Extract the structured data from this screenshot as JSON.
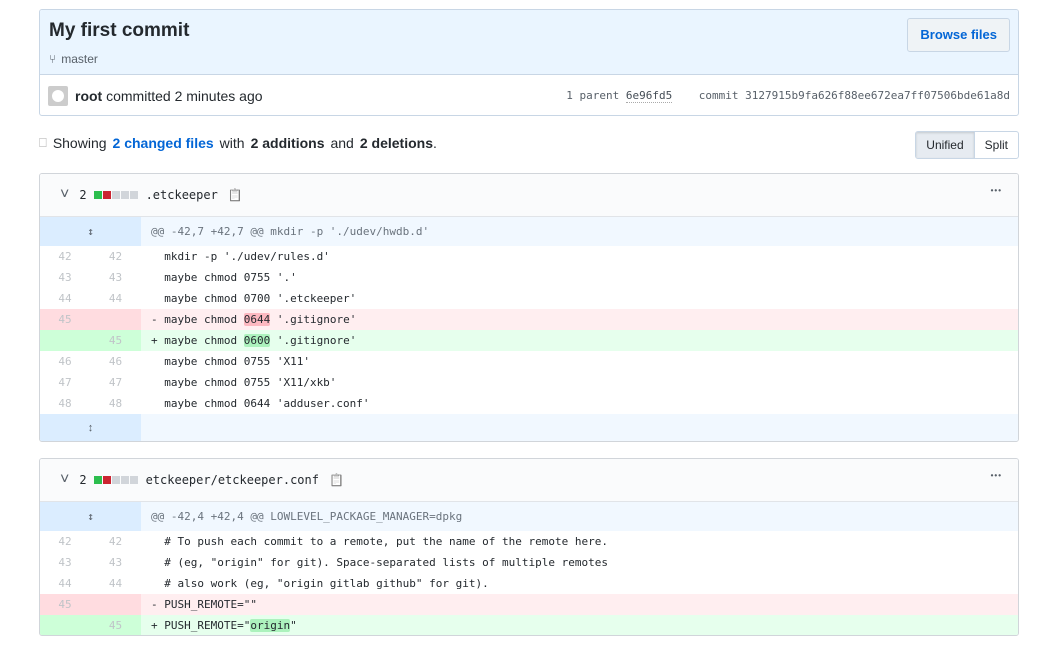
{
  "commit": {
    "title": "My first commit",
    "branch": "master",
    "browse_label": "Browse files",
    "author": "root",
    "action": "committed 2 minutes ago",
    "parent_label": "1 parent",
    "parent_sha": "6e96fd5",
    "commit_label": "commit",
    "commit_sha": "3127915b9fa626f88ee672ea7ff07506bde61a8d"
  },
  "summary": {
    "showing": "Showing",
    "files": "2 changed files",
    "with": "with",
    "additions": "2 additions",
    "and": "and",
    "deletions": "2 deletions",
    "period": "."
  },
  "view_toggle": {
    "unified": "Unified",
    "split": "Split",
    "selected": "Unified"
  },
  "files": [
    {
      "changes": "2",
      "name": ".etckeeper",
      "hunk": "@@ -42,7 +42,7 @@ mkdir -p './udev/hwdb.d'",
      "lines": [
        {
          "type": "ctx",
          "old": "42",
          "new": "42",
          "pre": "  mkdir -p './udev/rules.d'"
        },
        {
          "type": "ctx",
          "old": "43",
          "new": "43",
          "pre": "  maybe chmod 0755 '.'"
        },
        {
          "type": "ctx",
          "old": "44",
          "new": "44",
          "pre": "  maybe chmod 0700 '.etckeeper'"
        },
        {
          "type": "del",
          "old": "45",
          "new": "",
          "pre": "- maybe chmod ",
          "hl": "0644",
          "post": " '.gitignore'"
        },
        {
          "type": "add",
          "old": "",
          "new": "45",
          "pre": "+ maybe chmod ",
          "hl": "0600",
          "post": " '.gitignore'"
        },
        {
          "type": "ctx",
          "old": "46",
          "new": "46",
          "pre": "  maybe chmod 0755 'X11'"
        },
        {
          "type": "ctx",
          "old": "47",
          "new": "47",
          "pre": "  maybe chmod 0755 'X11/xkb'"
        },
        {
          "type": "ctx",
          "old": "48",
          "new": "48",
          "pre": "  maybe chmod 0644 'adduser.conf'"
        }
      ],
      "expand_below": true
    },
    {
      "changes": "2",
      "name": "etckeeper/etckeeper.conf",
      "hunk": "@@ -42,4 +42,4 @@ LOWLEVEL_PACKAGE_MANAGER=dpkg",
      "lines": [
        {
          "type": "ctx",
          "old": "42",
          "new": "42",
          "pre": "  # To push each commit to a remote, put the name of the remote here."
        },
        {
          "type": "ctx",
          "old": "43",
          "new": "43",
          "pre": "  # (eg, \"origin\" for git). Space-separated lists of multiple remotes"
        },
        {
          "type": "ctx",
          "old": "44",
          "new": "44",
          "pre": "  # also work (eg, \"origin gitlab github\" for git)."
        },
        {
          "type": "del",
          "old": "45",
          "new": "",
          "pre": "- PUSH_REMOTE=\"\""
        },
        {
          "type": "add",
          "old": "",
          "new": "45",
          "pre": "+ PUSH_REMOTE=\"",
          "hl": "origin",
          "post": "\""
        }
      ],
      "expand_below": false
    }
  ]
}
